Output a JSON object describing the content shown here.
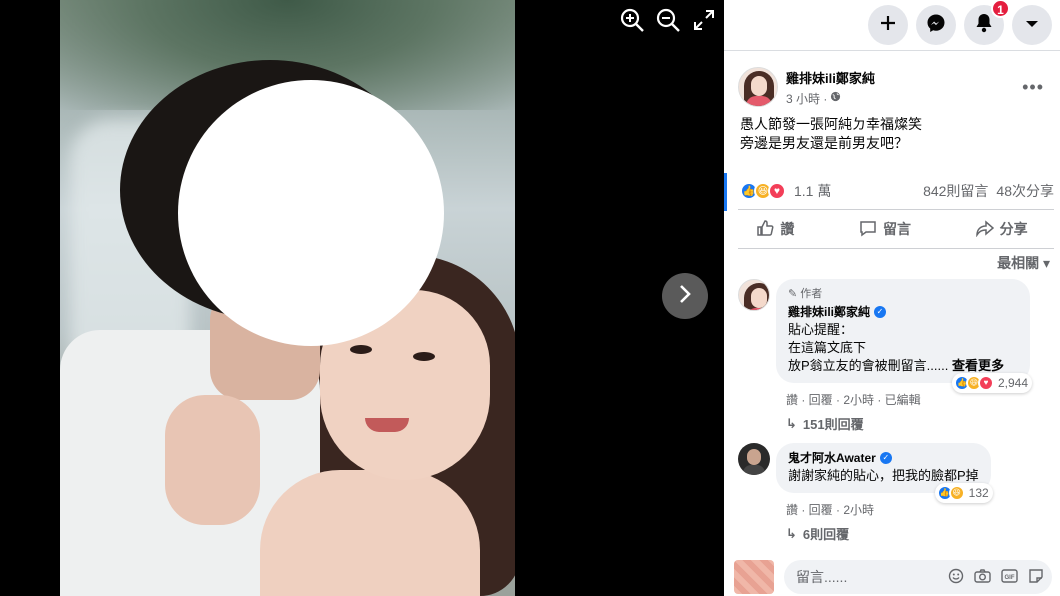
{
  "viewer": {
    "tools": [
      "zoom-in-icon",
      "zoom-out-icon",
      "fullscreen-icon"
    ],
    "next_icon": "chevron-right-icon"
  },
  "topbar": {
    "buttons": [
      "plus-icon",
      "messenger-icon",
      "bell-icon",
      "caret-down-icon"
    ],
    "notification_count": "1"
  },
  "post": {
    "author": "雞排妹ili鄭家純",
    "time": "3 小時 ·",
    "text_line1": "愚人節發一張阿純ㄉ幸福燦笑",
    "text_line2": "旁邊是男友還是前男友吧？",
    "reaction_count": "1.1 萬",
    "comments_count": "842則留言",
    "shares_count": "48次分享",
    "actions": {
      "like": "讚",
      "comment": "留言",
      "share": "分享"
    },
    "sort_label": "最相關"
  },
  "comments": [
    {
      "author_tag": "作者",
      "author": "雞排妹ili鄭家純",
      "line1": "貼心提醒：",
      "line2": "在這篇文底下",
      "line3": "放P翁立友的會被刪留言......",
      "see_more": "查看更多",
      "react_count": "2,944",
      "links": "讚 · 回覆 · 2小時 · 已編輯",
      "replies": "151則回覆"
    },
    {
      "author": "鬼才阿水Awater",
      "line1": "謝謝家純的貼心，把我的臉都P掉",
      "react_count": "132",
      "links": "讚 · 回覆 · 2小時",
      "replies": "6則回覆"
    }
  ],
  "composer": {
    "placeholder": "留言......",
    "icons": [
      "emoji-icon",
      "camera-icon",
      "gif-icon",
      "sticker-icon"
    ]
  },
  "colors": {
    "accent": "#1877f2",
    "badge": "#e41e3f"
  }
}
